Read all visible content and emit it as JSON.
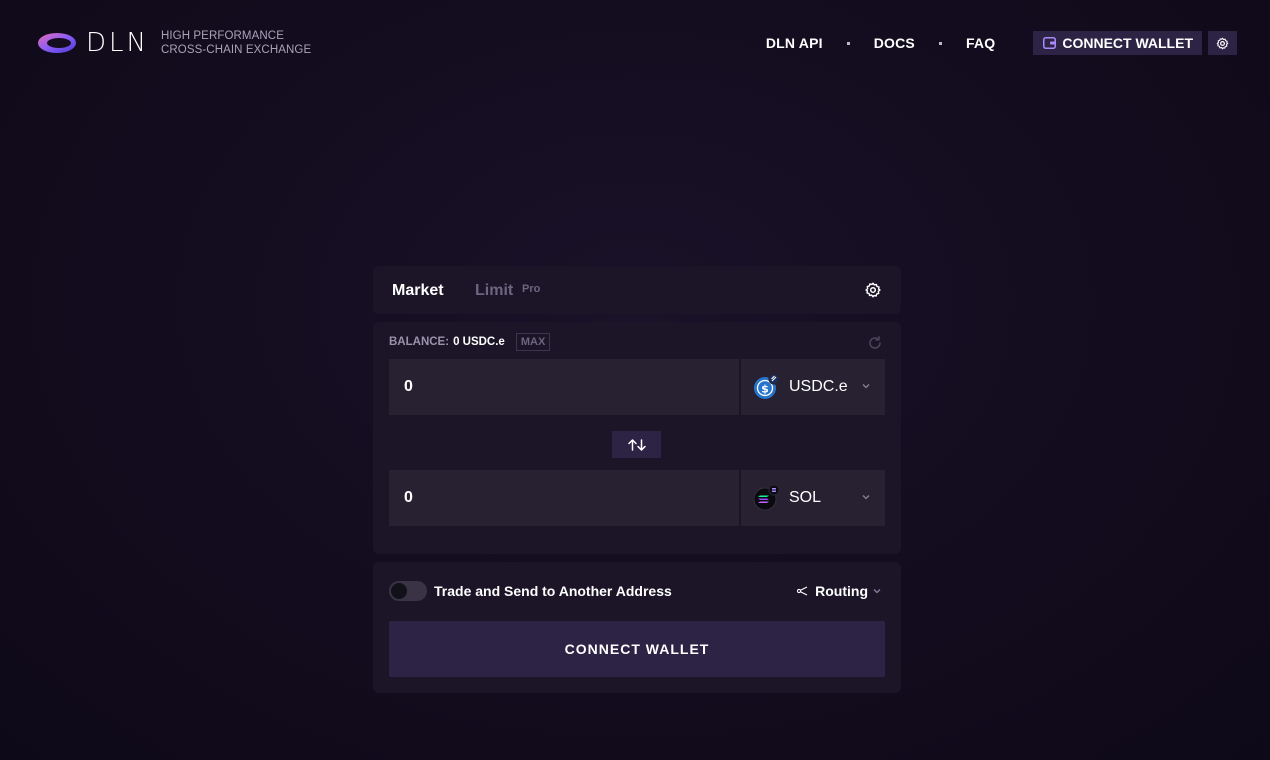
{
  "header": {
    "logo_text": "DLN",
    "tagline_line1": "HIGH PERFORMANCE",
    "tagline_line2": "CROSS-CHAIN EXCHANGE",
    "nav": [
      {
        "label": "DLN API"
      },
      {
        "label": "DOCS"
      },
      {
        "label": "FAQ"
      }
    ],
    "connect_wallet_label": "CONNECT WALLET"
  },
  "tabs": {
    "market_label": "Market",
    "limit_label": "Limit",
    "pro_badge": "Pro"
  },
  "swap": {
    "balance_label": "BALANCE:",
    "balance_value": "0 USDC.e",
    "max_label": "MAX",
    "from": {
      "amount": "0",
      "token": "USDC.e",
      "token_icon": "usdc-icon"
    },
    "to": {
      "amount": "0",
      "token": "SOL",
      "token_icon": "solana-icon"
    }
  },
  "action": {
    "toggle_label": "Trade and Send to Another Address",
    "toggle_on": false,
    "routing_label": "Routing",
    "connect_wallet_label": "CONNECT WALLET"
  },
  "colors": {
    "background": "#140d20",
    "card": "#1b1527",
    "field": "#272132",
    "accent": "#2d2344",
    "usdc_blue": "#2775ca"
  }
}
